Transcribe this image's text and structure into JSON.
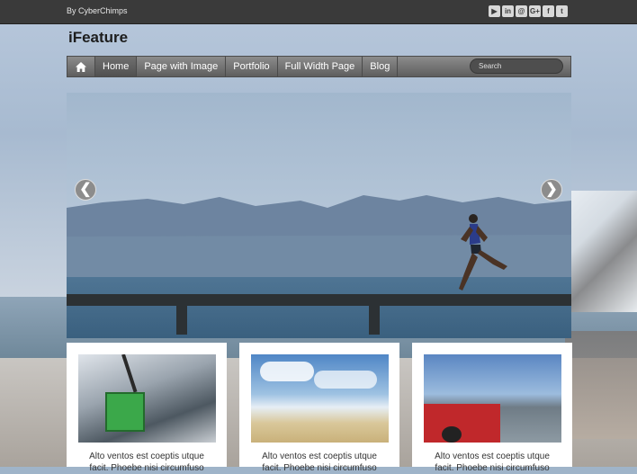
{
  "topbar": {
    "by": "By CyberChimps",
    "social_icons": [
      "youtube-icon",
      "linkedin-icon",
      "pinterest-icon",
      "google-plus-icon",
      "facebook-icon",
      "twitter-icon"
    ],
    "social_glyphs": [
      "▶",
      "in",
      "@",
      "G+",
      "f",
      "t"
    ]
  },
  "site": {
    "title": "iFeature"
  },
  "nav": {
    "home_icon": "home-icon",
    "items": [
      "Home",
      "Page with Image",
      "Portfolio",
      "Full Width Page",
      "Blog"
    ],
    "active": "Home",
    "search_placeholder": "Search"
  },
  "slider": {
    "prev": "❮",
    "next": "❯"
  },
  "cards": [
    {
      "image": "cable-car",
      "text": "Alto ventos est coeptis utque",
      "text2": "facit. Phoebe nisi circumfuso"
    },
    {
      "image": "beach-runners",
      "text": "Alto ventos est coeptis utque",
      "text2": "facit. Phoebe nisi circumfuso"
    },
    {
      "image": "jeep-people",
      "text": "Alto ventos est coeptis utque",
      "text2": "facit. Phoebe nisi circumfuso"
    }
  ],
  "colors": {
    "topbar": "#3a3a3a",
    "nav": "#6e6e6e",
    "card": "#ffffff"
  }
}
